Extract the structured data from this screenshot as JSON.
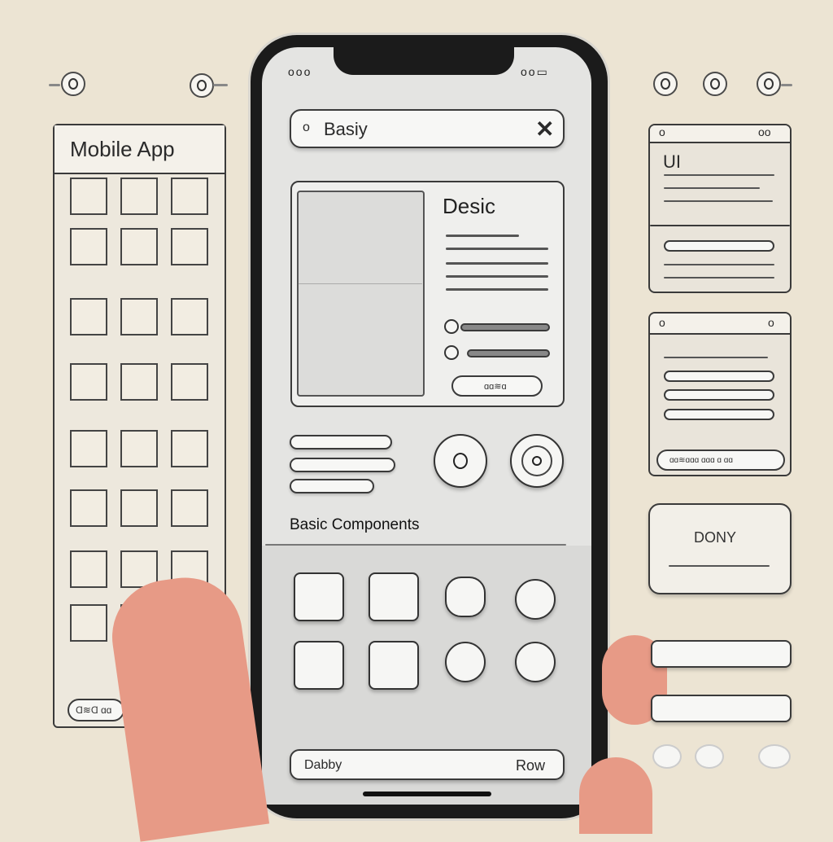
{
  "left_panel": {
    "title": "Mobile App",
    "footer_button": "Ɑ≋Ɑ ɑɑ"
  },
  "phone": {
    "search": {
      "value": "Basiy",
      "leading_icon": "circle-icon",
      "clear_icon": "close-icon"
    },
    "card": {
      "title": "Desic",
      "button_label": "ɑɑ≋ɑ"
    },
    "section_title": "Basic Components",
    "bottom_bar": {
      "left_label": "Dabby",
      "right_label": "Row"
    }
  },
  "right_panel": {
    "panel1_title": "UI",
    "panel2_footer": "ɑɑ≋ɑɑɑ ɑɑɑ ɑ ɑɑ",
    "panel3_title": "DONY"
  },
  "colors": {
    "background": "#ece4d3",
    "phone_body": "#1b1b1b",
    "screen": "#e4e4e2",
    "skin": "#e79a86"
  }
}
